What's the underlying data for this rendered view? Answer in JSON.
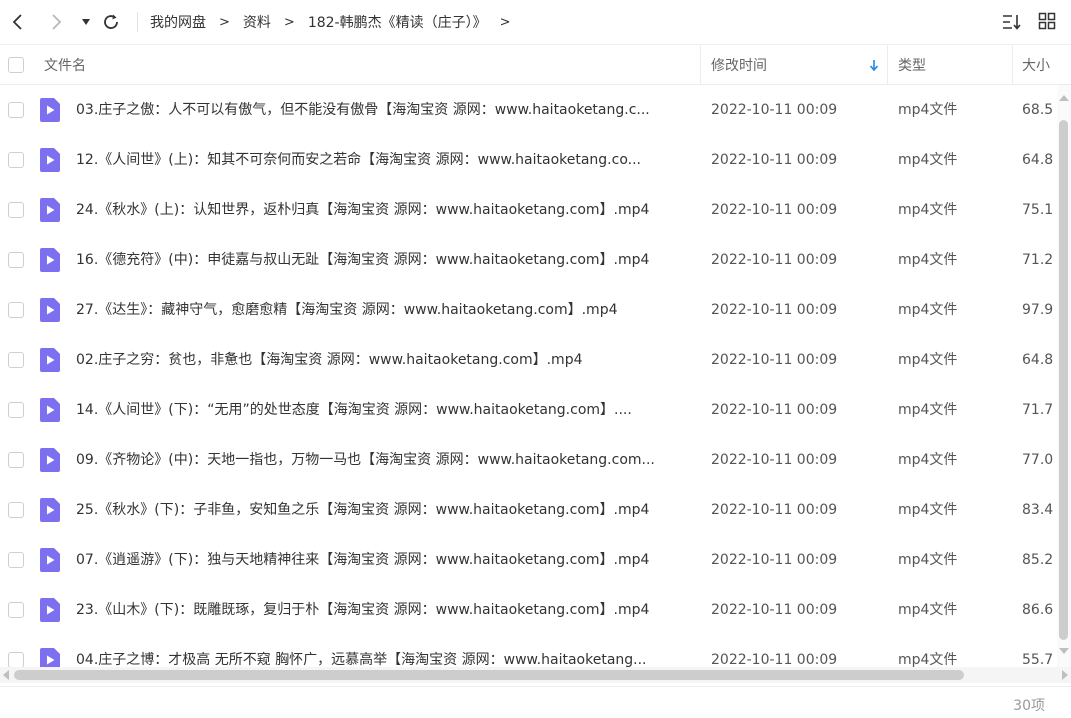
{
  "toolbar": {
    "back_icon": "chevron-left-icon",
    "forward_icon": "chevron-right-icon",
    "history_icon": "caret-down-icon",
    "refresh_icon": "refresh-icon",
    "sort_icon": "sort-list-icon",
    "view_icon": "grid-view-icon",
    "breadcrumbs": [
      "我的网盘",
      "资料",
      "182-韩鹏杰《精读（庄子）》"
    ],
    "crumb_separator": ">"
  },
  "header": {
    "name": "文件名",
    "modified": "修改时间",
    "type": "类型",
    "size": "大小",
    "sort_indicator": "arrow-down-icon"
  },
  "colors": {
    "file_icon": "#7c6ff0",
    "sort_arrow": "#1e88e5"
  },
  "files": [
    {
      "name": "03.庄子之傲：人不可以有傲气，但不能没有傲骨【海淘宝资 源网：www.haitaoketang.c...",
      "date": "2022-10-11 00:09",
      "type": "mp4文件",
      "size": "68.5"
    },
    {
      "name": "12.《人间世》(上)：知其不可奈何而安之若命【海淘宝资 源网：www.haitaoketang.co...",
      "date": "2022-10-11 00:09",
      "type": "mp4文件",
      "size": "64.8"
    },
    {
      "name": "24.《秋水》(上)：认知世界，返朴归真【海淘宝资 源网：www.haitaoketang.com】.mp4",
      "date": "2022-10-11 00:09",
      "type": "mp4文件",
      "size": "75.1"
    },
    {
      "name": "16.《德充符》(中)：申徒嘉与叔山无趾【海淘宝资 源网：www.haitaoketang.com】.mp4",
      "date": "2022-10-11 00:09",
      "type": "mp4文件",
      "size": "71.2"
    },
    {
      "name": "27.《达生》：藏神守气，愈磨愈精【海淘宝资 源网：www.haitaoketang.com】.mp4",
      "date": "2022-10-11 00:09",
      "type": "mp4文件",
      "size": "97.9"
    },
    {
      "name": "02.庄子之穷：贫也，非惫也【海淘宝资 源网：www.haitaoketang.com】.mp4",
      "date": "2022-10-11 00:09",
      "type": "mp4文件",
      "size": "64.8"
    },
    {
      "name": "14.《人间世》(下)：“无用”的处世态度【海淘宝资 源网：www.haitaoketang.com】....",
      "date": "2022-10-11 00:09",
      "type": "mp4文件",
      "size": "71.7"
    },
    {
      "name": "09.《齐物论》(中)：天地一指也，万物一马也【海淘宝资 源网：www.haitaoketang.com...",
      "date": "2022-10-11 00:09",
      "type": "mp4文件",
      "size": "77.0"
    },
    {
      "name": "25.《秋水》(下)：子非鱼，安知鱼之乐【海淘宝资 源网：www.haitaoketang.com】.mp4",
      "date": "2022-10-11 00:09",
      "type": "mp4文件",
      "size": "83.4"
    },
    {
      "name": "07.《逍遥游》(下)：独与天地精神往来【海淘宝资 源网：www.haitaoketang.com】.mp4",
      "date": "2022-10-11 00:09",
      "type": "mp4文件",
      "size": "85.2"
    },
    {
      "name": "23.《山木》(下)：既雕既琢，复归于朴【海淘宝资 源网：www.haitaoketang.com】.mp4",
      "date": "2022-10-11 00:09",
      "type": "mp4文件",
      "size": "86.6"
    },
    {
      "name": "04.庄子之博：才极高 无所不窥 胸怀广，远慕高举【海淘宝资 源网：www.haitaoketang...",
      "date": "2022-10-11 00:09",
      "type": "mp4文件",
      "size": "55.7"
    }
  ],
  "footer": {
    "count": "30项"
  }
}
